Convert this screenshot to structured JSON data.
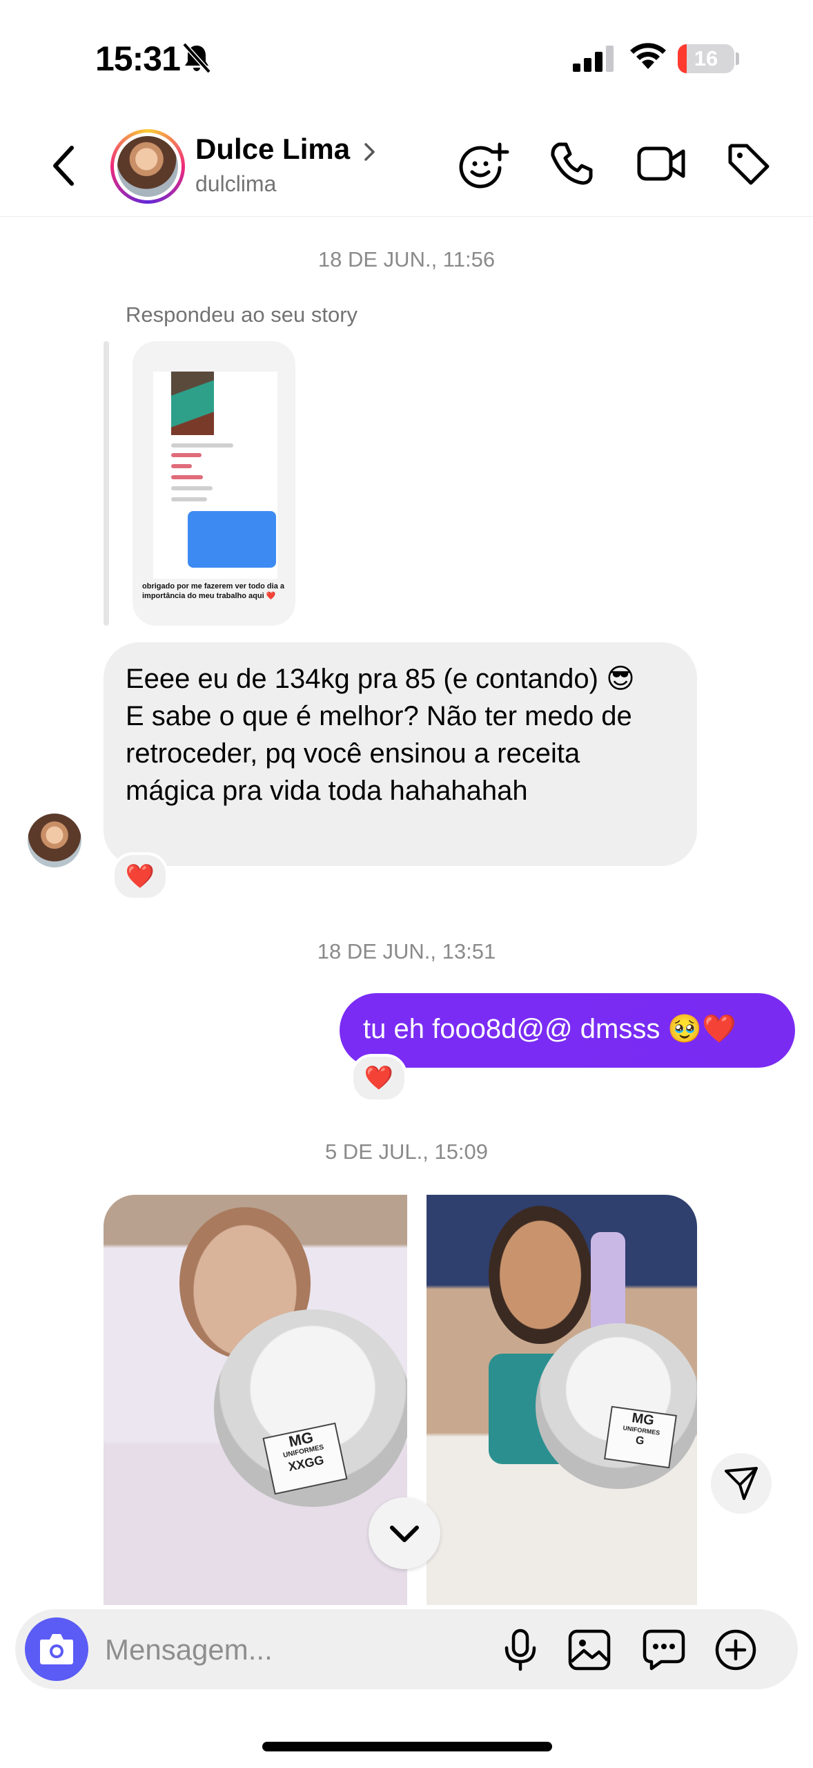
{
  "status_bar": {
    "time": "15:31",
    "battery": "16",
    "battery_level": 0.16
  },
  "header": {
    "name": "Dulce Lima",
    "handle": "dulclima"
  },
  "messages": {
    "ts1": "18 DE JUN., 11:56",
    "reply_label": "Respondeu ao seu story",
    "story_caption": "obrigado por me fazerem ver todo dia a importância do meu trabalho aqui ❤️",
    "incoming_text": "Eeee eu de 134kg pra 85 (e contando) 😎\nE sabe o que é melhor? Não ter medo de retroceder, pq você ensinou a receita mágica pra vida toda hahahahah",
    "incoming_reaction": "❤️",
    "ts2": "18 DE JUN., 13:51",
    "outgoing_text": "tu eh fooo8d@@ dmsss 🥹❤️",
    "outgoing_reaction": "❤️",
    "ts3": "5 DE JUL., 15:09",
    "photo_left_tag": "XXGG",
    "photo_right_tag": "G",
    "photo_brand": "MG",
    "photo_brand_sub": "UNIFORMES"
  },
  "composer": {
    "placeholder": "Mensagem..."
  },
  "colors": {
    "outgoing_bubble": "#7a2cf5",
    "camera_button": "#5b5bf5",
    "incoming_bubble": "#efefef"
  }
}
